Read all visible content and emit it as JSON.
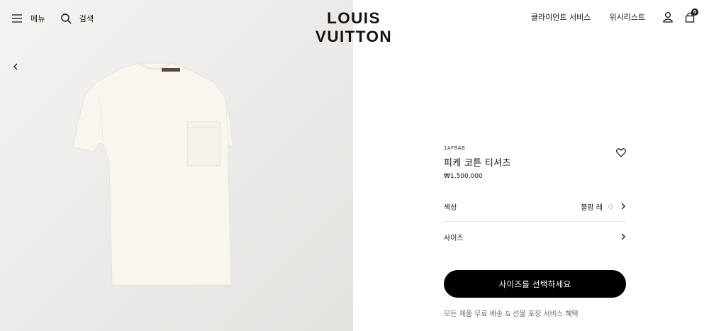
{
  "header": {
    "menu_label": "메뉴",
    "search_label": "검색",
    "logo": "LOUIS VUITTON",
    "client_services": "클라이언트 서비스",
    "wishlist": "위시리스트",
    "cart_count": "0"
  },
  "product": {
    "sku": "1AFBAB",
    "name": "피케 코튼 티셔츠",
    "price": "₩1,500,000",
    "color_label": "색상",
    "color_value": "블랑 레",
    "size_label": "사이즈",
    "cta_label": "사이즈를 선택하세요",
    "notice": "모든 제품 무료 배송 & 선물 포장 서비스 혜택"
  },
  "colors": {
    "text": "#19110b",
    "cta_bg": "#000000",
    "image_bg": "#ebeae8",
    "shirt": "#f7f5ee"
  },
  "icons": [
    "hamburger-icon",
    "search-icon",
    "account-icon",
    "shopping-bag-icon",
    "chevron-left-icon",
    "heart-icon",
    "chevron-right-icon"
  ]
}
